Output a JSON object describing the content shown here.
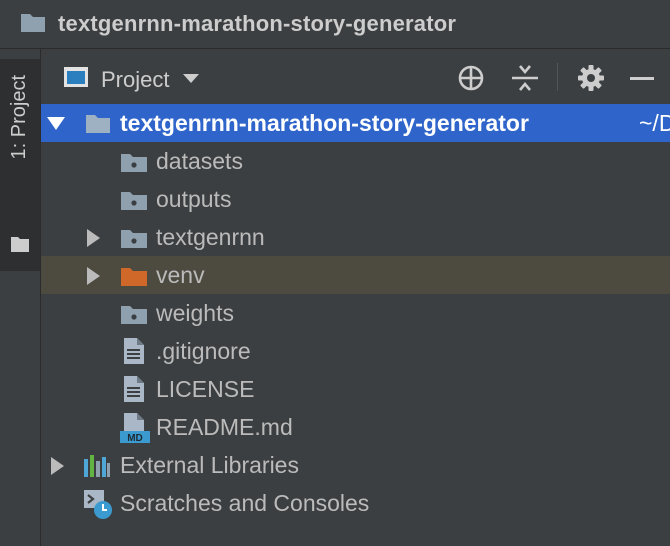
{
  "window": {
    "title": "textgenrnn-marathon-story-generator"
  },
  "side_stripe": {
    "tab_label": "1: Project"
  },
  "tool_header": {
    "combo_label": "Project",
    "buttons": [
      "locate-icon",
      "collapse-all-icon",
      "gear-icon",
      "minimize-icon"
    ]
  },
  "tree": {
    "root": {
      "label": "textgenrnn-marathon-story-generator",
      "path": "~/D"
    },
    "items": [
      {
        "label": "datasets",
        "icon": "folder-icon"
      },
      {
        "label": "outputs",
        "icon": "folder-icon"
      },
      {
        "label": "textgenrnn",
        "icon": "folder-icon",
        "expandable": true
      },
      {
        "label": "venv",
        "icon": "excluded-folder-icon",
        "expandable": true
      },
      {
        "label": "weights",
        "icon": "folder-icon"
      },
      {
        "label": ".gitignore",
        "icon": "text-file-icon"
      },
      {
        "label": "LICENSE",
        "icon": "text-file-icon"
      },
      {
        "label": "README.md",
        "icon": "markdown-file-icon",
        "badge": "MD"
      }
    ],
    "external_libraries": {
      "label": "External Libraries"
    },
    "scratches": {
      "label": "Scratches and Consoles"
    }
  },
  "colors": {
    "background": "#3c3f41",
    "selection": "#2f65ca",
    "highlight_row": "#4d4a40",
    "folder": "#8fa0ae",
    "excluded_folder": "#d0682a",
    "md_badge": "#3b9bd0"
  }
}
